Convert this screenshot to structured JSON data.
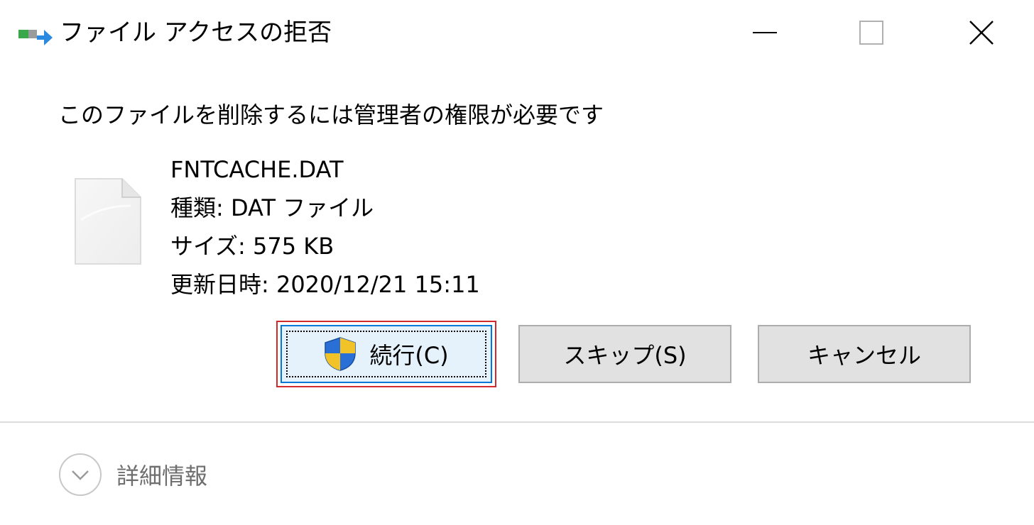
{
  "window": {
    "title": "ファイル アクセスの拒否",
    "controls": {
      "minimize": "minimize-icon",
      "maximize": "maximize-icon",
      "close": "close-icon"
    }
  },
  "message": "このファイルを削除するには管理者の権限が必要です",
  "file": {
    "icon": "document-icon",
    "name": "FNTCACHE.DAT",
    "type_line": "種類: DAT ファイル",
    "size_line": "サイズ: 575 KB",
    "modified_line": "更新日時: 2020/12/21 15:11"
  },
  "buttons": {
    "continue_label": "続行(C)",
    "skip_label": "スキップ(S)",
    "cancel_label": "キャンセル"
  },
  "details": {
    "label": "詳細情報",
    "icon": "chevron-down-circle-icon"
  },
  "colors": {
    "highlight_frame": "#d22a2a",
    "primary_button_bg": "#e5f1fb",
    "primary_button_border": "#0078d7",
    "button_bg": "#e1e1e1",
    "muted_text": "#6e6e6e"
  }
}
